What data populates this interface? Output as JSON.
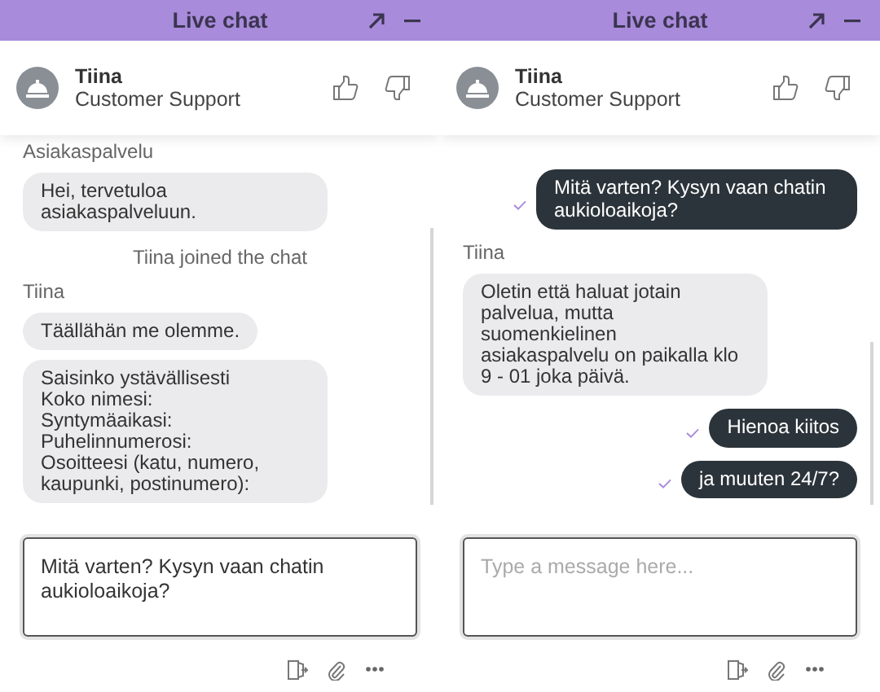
{
  "panels": [
    {
      "title": "Live chat",
      "agent": {
        "name": "Tiina",
        "role": "Customer Support"
      },
      "messages": [
        {
          "kind": "label",
          "text": "Asiakaspalvelu"
        },
        {
          "kind": "agent",
          "text": "Hei, tervetuloa asiakaspalveluun."
        },
        {
          "kind": "system",
          "text": "Tiina joined the chat"
        },
        {
          "kind": "label",
          "text": "Tiina"
        },
        {
          "kind": "agent",
          "text": "Täällähän me olemme."
        },
        {
          "kind": "agent",
          "text": "Saisinko ystävällisesti\nKoko nimesi:\nSyntymäaikasi:\nPuhelinnumerosi:\nOsoitteesi (katu, numero, kaupunki, postinumero):"
        }
      ],
      "composer": {
        "value": "Mitä varten? Kysyn vaan chatin aukioloaikoja?"
      }
    },
    {
      "title": "Live chat",
      "agent": {
        "name": "Tiina",
        "role": "Customer Support"
      },
      "messages": [
        {
          "kind": "visitor",
          "text": "Mitä varten? Kysyn vaan chatin aukioloaikoja?",
          "delivered": true
        },
        {
          "kind": "label",
          "text": "Tiina"
        },
        {
          "kind": "agent",
          "text": "Oletin että haluat jotain palvelua, mutta suomenkielinen asiakaspalvelu on paikalla klo 9 - 01 joka päivä."
        },
        {
          "kind": "visitor",
          "text": "Hienoa kiitos",
          "delivered": true
        },
        {
          "kind": "visitor",
          "text": "ja muuten 24/7?",
          "delivered": true
        }
      ],
      "composer": {
        "placeholder": "Type a message here..."
      }
    }
  ]
}
